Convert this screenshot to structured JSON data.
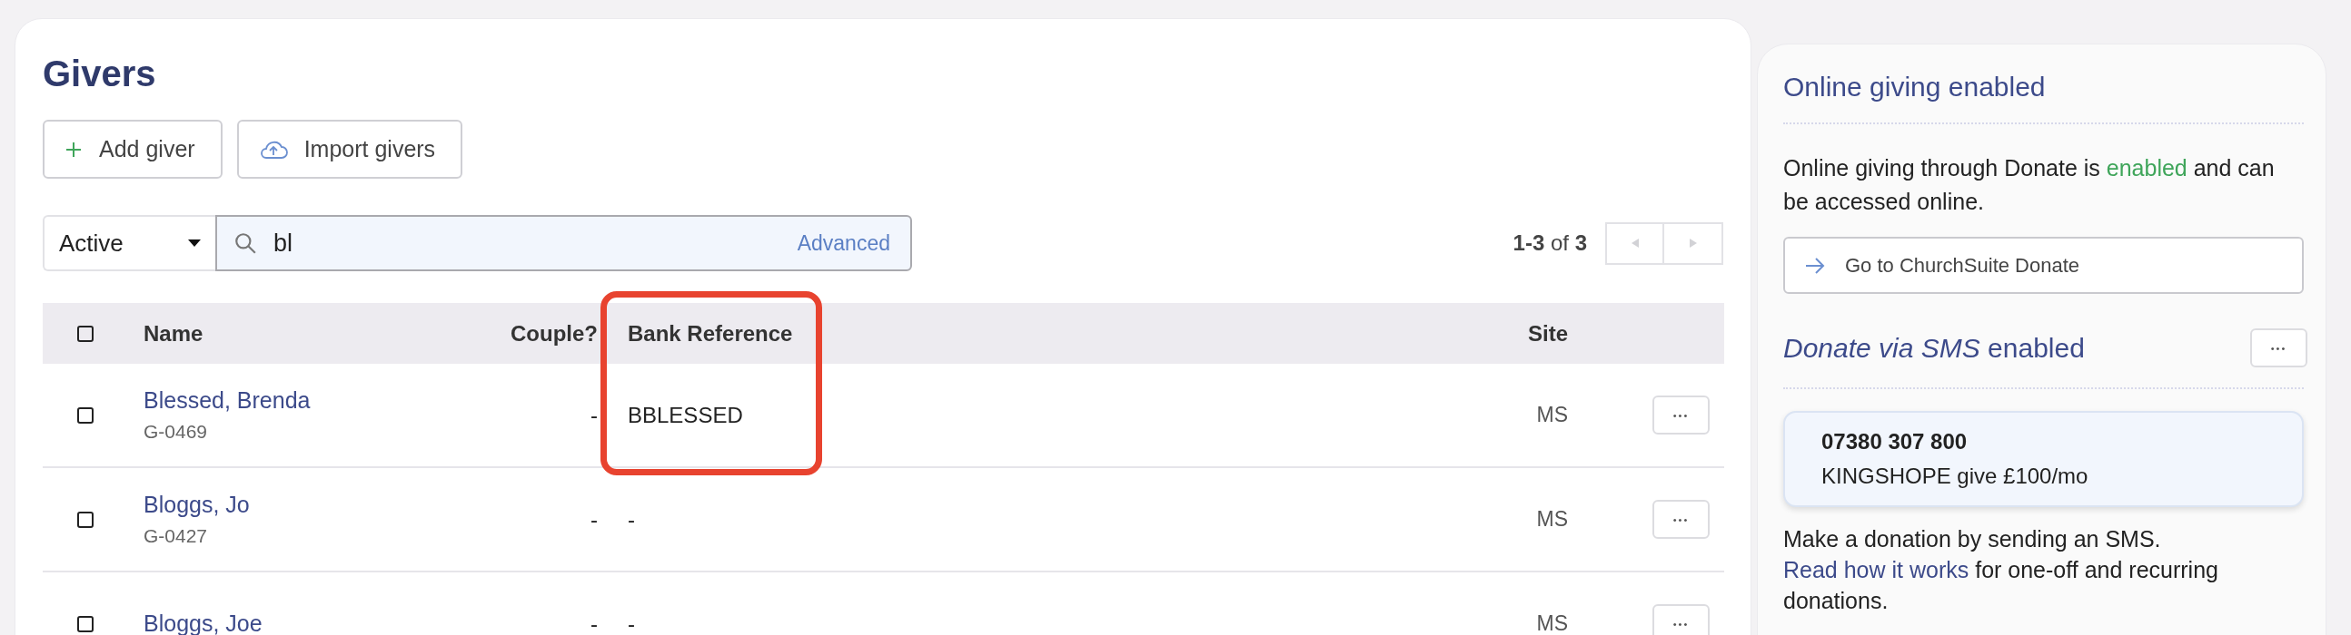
{
  "title": "Givers",
  "actions": [
    {
      "label": "Add giver",
      "kind": "add"
    },
    {
      "label": "Import givers",
      "kind": "import"
    }
  ],
  "filter": {
    "status": "Active",
    "search_value": "bl",
    "advanced_link": "Advanced"
  },
  "pagination": {
    "range": "**1-3** of **3**",
    "prev_disabled": true,
    "next_disabled": true
  },
  "table": {
    "select_all_checked": false,
    "columns": [
      {
        "label": "Name",
        "highlighted": false
      },
      {
        "label": "Couple?",
        "highlighted": false
      },
      {
        "label": "Bank Reference",
        "highlighted": true
      },
      {
        "label": "Site",
        "highlighted": false
      }
    ],
    "rows": [
      {
        "checked": false,
        "name": "Blessed, Brenda",
        "id": "G-0469",
        "couple": "-",
        "bank_reference": "BBLESSED",
        "site": "MS",
        "more": "•••"
      },
      {
        "checked": false,
        "name": "Bloggs, Jo",
        "id": "G-0427",
        "couple": "-",
        "bank_reference": "-",
        "site": "MS",
        "more": "•••"
      },
      {
        "checked": false,
        "name": "Bloggs, Joe",
        "couple": "-",
        "bank_reference": "-",
        "site": "MS",
        "more": "•••"
      }
    ]
  },
  "sidebar": {
    "online_heading": "Online giving enabled",
    "online_text_before": "Online giving through Donate is",
    "online_status": "enabled",
    "online_text_after": "and can be accessed online.",
    "donate_button": "Go to ChurchSuite Donate",
    "sms_heading_italic": "Donate via SMS",
    "sms_heading_rest": "enabled",
    "sms_more": "•••",
    "sms_number": "07380 307 800",
    "sms_message": "KINGSHOPE give £100/mo",
    "sms_text": "Make a donation by sending an SMS.",
    "sms_link": "Read how it works",
    "sms_text_after": "for one-off and recurring donations."
  }
}
